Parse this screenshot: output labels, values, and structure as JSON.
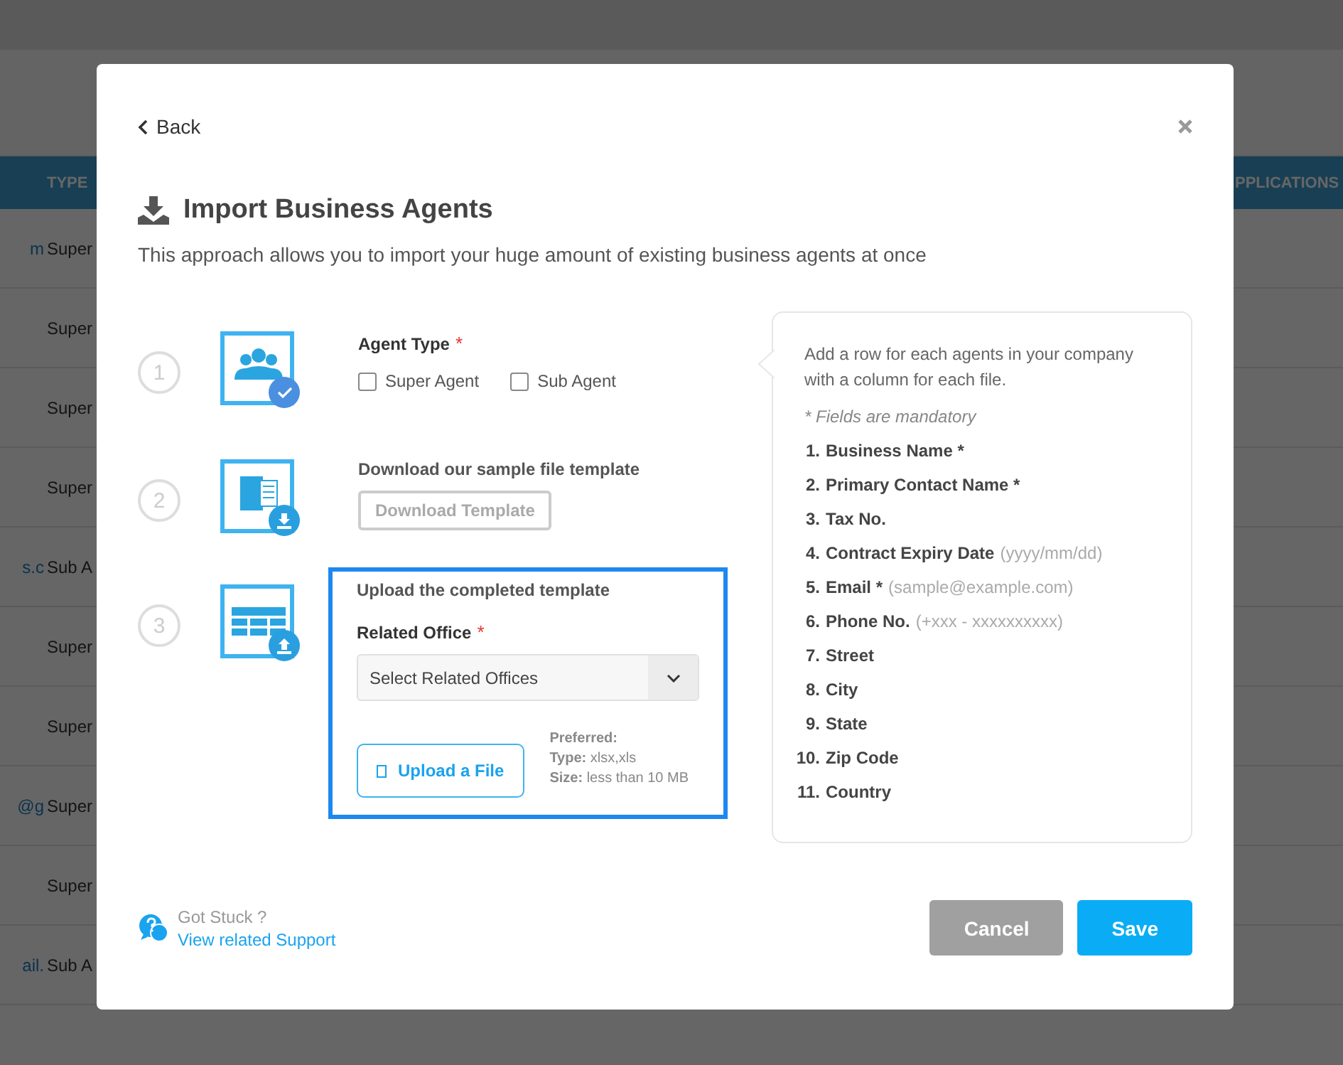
{
  "background": {
    "table": {
      "columns": [
        "TYPE",
        "PPLICATIONS"
      ],
      "rows": [
        {
          "column_1": "m",
          "type": "Super"
        },
        {
          "type": "Super"
        },
        {
          "type": "Super"
        },
        {
          "type": "Super"
        },
        {
          "column_1": "s.c",
          "type": "Sub A"
        },
        {
          "type": "Super"
        },
        {
          "type": "Super"
        },
        {
          "column_1": "@g",
          "type": "Super"
        },
        {
          "type": "Super"
        },
        {
          "column_1": "ail.",
          "type": "Sub A"
        }
      ]
    }
  },
  "modal": {
    "back": "Back",
    "title": "Import Business Agents",
    "description": "This approach allows you to import your huge amount of existing business agents at once",
    "steps": [
      {
        "number": "1",
        "kind": "agent_type",
        "highlighted": false,
        "label": "Agent Type",
        "required_mark": "*",
        "options": [
          {
            "label": "Super Agent",
            "checked": false
          },
          {
            "label": "Sub Agent",
            "checked": false
          }
        ]
      },
      {
        "number": "2",
        "kind": "download",
        "highlighted": false,
        "label": "Download our sample file template",
        "button": "Download Template"
      },
      {
        "number": "3",
        "kind": "upload",
        "highlighted": true,
        "label": "Upload the completed template",
        "field_label": "Related Office",
        "required_mark": "*",
        "select_placeholder": "Select Related Offices",
        "upload_button": "Upload a File",
        "preferred": "Preferred:",
        "rules": [
          {
            "label": "Type:",
            "value": "xlsx,xls"
          },
          {
            "label": "Size:",
            "value": "less than 10 MB"
          }
        ]
      }
    ],
    "info": {
      "intro": "Add a row for each agents in your company with a column for each file.",
      "note": "* Fields are mandatory",
      "fields": [
        {
          "number": "1.",
          "name": "Business Name *"
        },
        {
          "number": "2.",
          "name": "Primary Contact Name *"
        },
        {
          "number": "3.",
          "name": "Tax No."
        },
        {
          "number": "4.",
          "name": "Contract Expiry Date",
          "hint": "(yyyy/mm/dd)"
        },
        {
          "number": "5.",
          "name": "Email *",
          "hint": "(sample@example.com)"
        },
        {
          "number": "6.",
          "name": "Phone No.",
          "hint": "(+xxx - xxxxxxxxxx)"
        },
        {
          "number": "7.",
          "name": "Street"
        },
        {
          "number": "8.",
          "name": "City"
        },
        {
          "number": "9.",
          "name": "State"
        },
        {
          "number": "10.",
          "name": "Zip Code"
        },
        {
          "number": "11.",
          "name": "Country"
        }
      ]
    },
    "help": {
      "text": "Got Stuck ?",
      "link": "View related Support"
    },
    "buttons": [
      {
        "label": "Cancel",
        "kind": "secondary"
      },
      {
        "label": "Save",
        "kind": "primary"
      }
    ]
  }
}
